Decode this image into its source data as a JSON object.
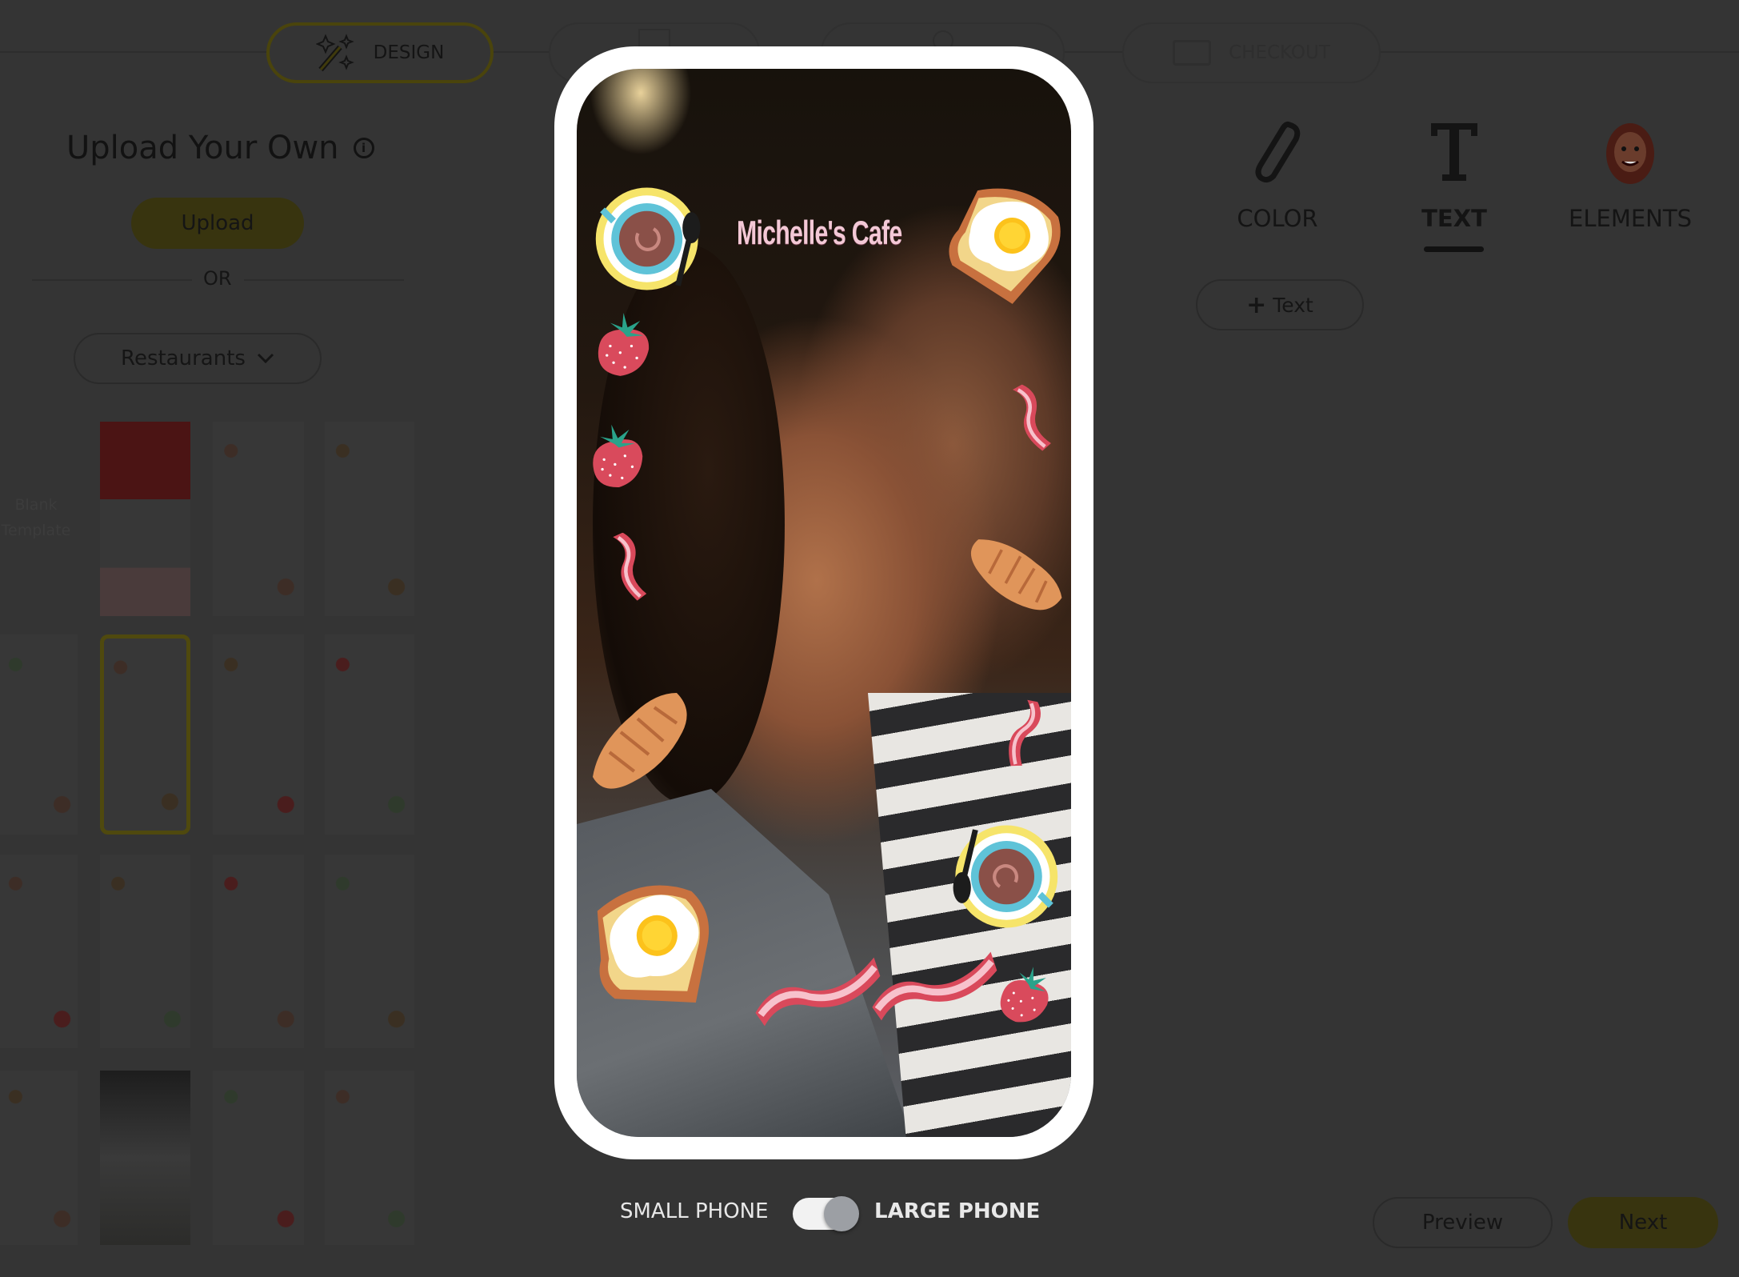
{
  "nav": {
    "steps": [
      {
        "label": "DESIGN",
        "icon": "magic-wand-icon",
        "active": true
      },
      {
        "label": "",
        "icon": "calendar-icon",
        "active": false
      },
      {
        "label": "",
        "icon": "location-icon",
        "active": false
      },
      {
        "label": "CHECKOUT",
        "icon": "card-icon",
        "active": false
      }
    ]
  },
  "left": {
    "title": "Upload Your Own",
    "info_icon": "i",
    "upload_label": "Upload",
    "or_label": "OR",
    "category": "Restaurants",
    "blank_template": "Blank Template"
  },
  "phone": {
    "overlay_text": "Michelle's Cafe",
    "overlay_text_color": "#f3c8d6"
  },
  "tools": {
    "color": "COLOR",
    "text": "TEXT",
    "elements": "ELEMENTS",
    "active": "TEXT",
    "add_text": "Text"
  },
  "bottom": {
    "small_phone": "SMALL PHONE",
    "large_phone": "LARGE PHONE",
    "large_selected": true,
    "preview": "Preview",
    "next": "Next"
  },
  "colors": {
    "accent": "#38340f",
    "background": "#343434"
  }
}
